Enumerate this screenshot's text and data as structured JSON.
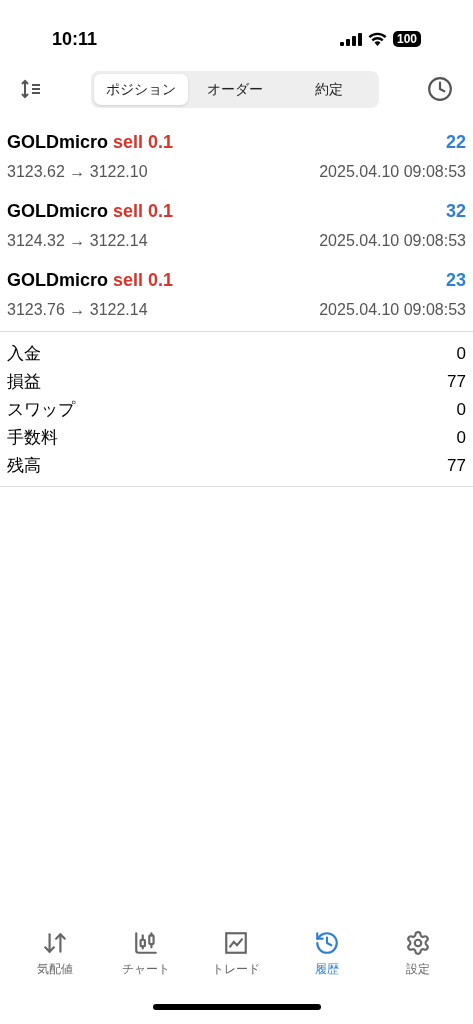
{
  "status_bar": {
    "time": "10:11",
    "battery": "100"
  },
  "tabs": [
    {
      "label": "ポジション",
      "selected": true
    },
    {
      "label": "オーダー",
      "selected": false
    },
    {
      "label": "約定",
      "selected": false
    }
  ],
  "trades": [
    {
      "symbol": "GOLDmicro",
      "side": "sell",
      "volume": "0.1",
      "profit": "22",
      "prices": "3123.62 → 3122.10",
      "time": "2025.04.10 09:08:53"
    },
    {
      "symbol": "GOLDmicro",
      "side": "sell",
      "volume": "0.1",
      "profit": "32",
      "prices": "3124.32 → 3122.14",
      "time": "2025.04.10 09:08:53"
    },
    {
      "symbol": "GOLDmicro",
      "side": "sell",
      "volume": "0.1",
      "profit": "23",
      "prices": "3123.76 → 3122.14",
      "time": "2025.04.10 09:08:53"
    }
  ],
  "summary": [
    {
      "label": "入金",
      "value": "0"
    },
    {
      "label": "損益",
      "value": "77"
    },
    {
      "label": "スワップ",
      "value": "0"
    },
    {
      "label": "手数料",
      "value": "0"
    },
    {
      "label": "残高",
      "value": "77"
    }
  ],
  "nav": [
    {
      "kind": "quotes",
      "label": "気配値",
      "selected": false
    },
    {
      "kind": "chart",
      "label": "チャート",
      "selected": false
    },
    {
      "kind": "trade",
      "label": "トレード",
      "selected": false
    },
    {
      "kind": "history",
      "label": "履歴",
      "selected": true
    },
    {
      "kind": "settings",
      "label": "設定",
      "selected": false
    }
  ]
}
